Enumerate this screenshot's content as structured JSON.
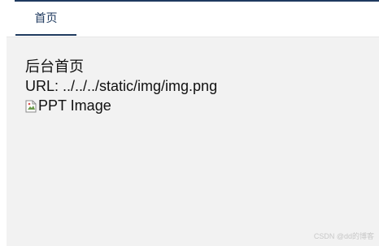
{
  "tabs": [
    {
      "label": "首页",
      "active": true
    }
  ],
  "content": {
    "heading": "后台首页",
    "url_line": "URL: ../../../static/img/img.png",
    "image_alt": "PPT Image"
  },
  "watermark": "CSDN @dd的博客",
  "colors": {
    "accent": "#1f3a5f",
    "content_bg": "#f2f2f2"
  }
}
